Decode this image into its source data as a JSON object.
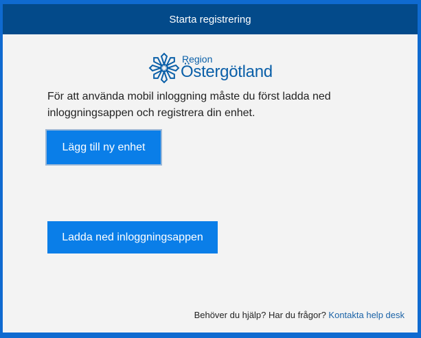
{
  "dialog": {
    "title": "Starta registrering"
  },
  "logo": {
    "region_text": "Region",
    "name_text": "Östergötland"
  },
  "intro_text": "För att använda mobil inloggning måste du först ladda ned inloggningsappen och registrera din enhet.",
  "buttons": {
    "add_device": "Lägg till ny enhet",
    "download_app": "Ladda ned inloggningsappen"
  },
  "help": {
    "question": "Behöver du hjälp? Har du frågor?",
    "link": "Kontakta help desk"
  },
  "colors": {
    "frame": "#0f6ad0",
    "titlebar": "#034a8a",
    "button": "#0a7ee8",
    "link": "#1b63a7"
  }
}
